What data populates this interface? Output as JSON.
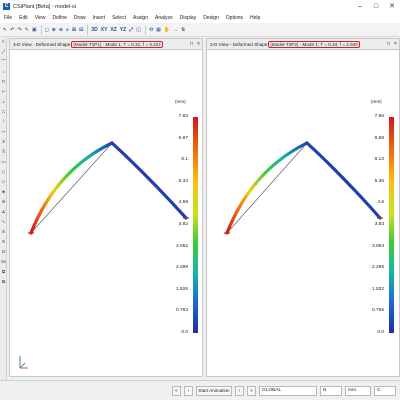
{
  "window": {
    "title": "CSiPlant [Beta] - model-si",
    "icon": "csiplant-app-icon"
  },
  "menu": [
    "File",
    "Edit",
    "View",
    "Define",
    "Draw",
    "Insert",
    "Select",
    "Assign",
    "Analyze",
    "Display",
    "Design",
    "Options",
    "Help"
  ],
  "toolbar": [
    "↖",
    "↶",
    "↷",
    "✎",
    "▣",
    "◻",
    "⊕",
    "⊖",
    "⌕",
    "⊞",
    "⊟",
    "3D",
    "XY",
    "XZ",
    "YZ",
    "⤢",
    "◱",
    "⟲",
    "▦",
    "✋",
    "↔",
    "⇅"
  ],
  "left_tools": [
    "↖",
    "╱",
    "⌒",
    "⌂",
    "⊓",
    "⊢",
    "⊥",
    "⎍",
    "⊺",
    "⊸",
    "⊻",
    "⊼",
    "▭",
    "▯",
    "◇",
    "◈",
    "⊛",
    "∡",
    "∿",
    "⋔",
    "≋",
    "⊡",
    "⋈",
    "⧉",
    "⊠"
  ],
  "views": [
    {
      "title": "3-D View - Deformed Shape",
      "info": "(Model-T1P1) - Mode 1; T = 0.31; f = 3.222",
      "unit": "(mm)",
      "scale_labels": [
        "7.63",
        "6.87",
        "6.1",
        "5.34",
        "4.58",
        "3.82",
        "3.052",
        "2.289",
        "1.526",
        "0.763",
        "0.0"
      ]
    },
    {
      "title": "3-D View - Deformed Shape",
      "info": "(Model-T2P2) - Mode 1; T = 0.34; f = 2.940",
      "unit": "(mm)",
      "scale_labels": [
        "7.66",
        "6.89",
        "6.13",
        "5.36",
        "4.6",
        "3.83",
        "3.064",
        "2.298",
        "1.532",
        "0.766",
        "0.0"
      ]
    }
  ],
  "status": {
    "animation_button": "Start Animation",
    "coord_system": "GLOBAL",
    "units_force": "N",
    "units_length": "mm",
    "units_temp": "C"
  },
  "colors": {
    "contour_high": "#d1161b",
    "contour_low": "#1c2fa0",
    "highlight": "#d0202a"
  }
}
